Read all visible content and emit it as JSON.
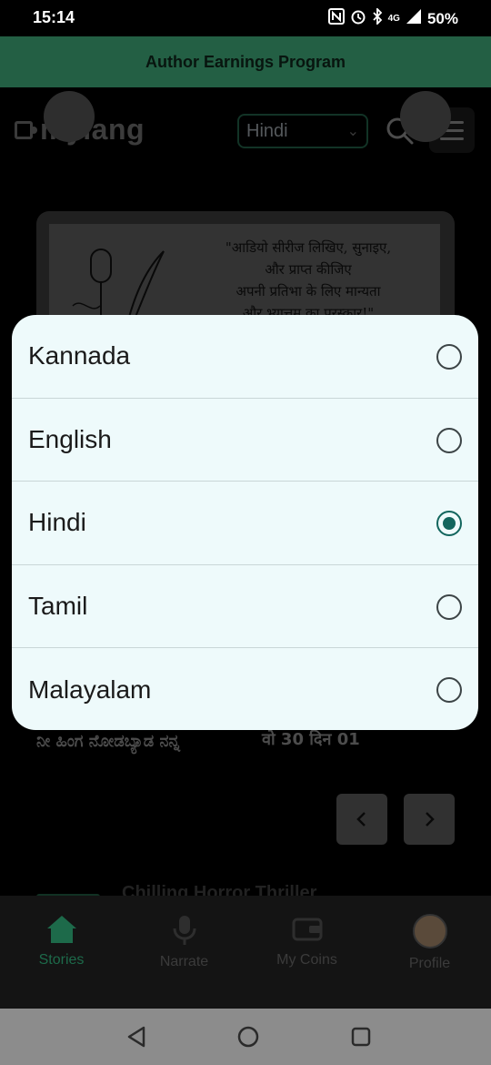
{
  "status_bar": {
    "time": "15:14",
    "network": "4G",
    "battery": "50%"
  },
  "banner": {
    "text": "Author Earnings Program"
  },
  "header": {
    "logo_text": "mylang",
    "language_select_value": "Hindi"
  },
  "promo": {
    "lines": [
      "\"आडियो सीरीज लिखिए, सुनाइए,",
      "और प्राप्त कीजिए",
      "अपनी प्रतिभा के लिए मान्यता",
      "और भ्यात्तम का पुरस्कार!\""
    ]
  },
  "stories": {
    "item1_title": "ನೀ ಹಿಂಗ ನೋಡಬ್ಯಾಡ ನನ್ನ",
    "item2_title": "वो 30 दिन 01",
    "pager_prev": "‹",
    "pager_next": "›",
    "next_section_title": "Chilling Horror Thriller"
  },
  "language_sheet": {
    "options": [
      {
        "label": "Kannada",
        "selected": false
      },
      {
        "label": "English",
        "selected": false
      },
      {
        "label": "Hindi",
        "selected": true
      },
      {
        "label": "Tamil",
        "selected": false
      },
      {
        "label": "Malayalam",
        "selected": false
      }
    ]
  },
  "bottom_nav": {
    "items": [
      {
        "label": "Stories",
        "icon": "home-icon",
        "active": true
      },
      {
        "label": "Narrate",
        "icon": "microphone-icon",
        "active": false
      },
      {
        "label": "My Coins",
        "icon": "wallet-icon",
        "active": false
      },
      {
        "label": "Profile",
        "icon": "avatar",
        "active": false
      }
    ]
  },
  "colors": {
    "accent": "#12655d",
    "banner": "#235f44",
    "sheet_bg": "#eefafb"
  }
}
